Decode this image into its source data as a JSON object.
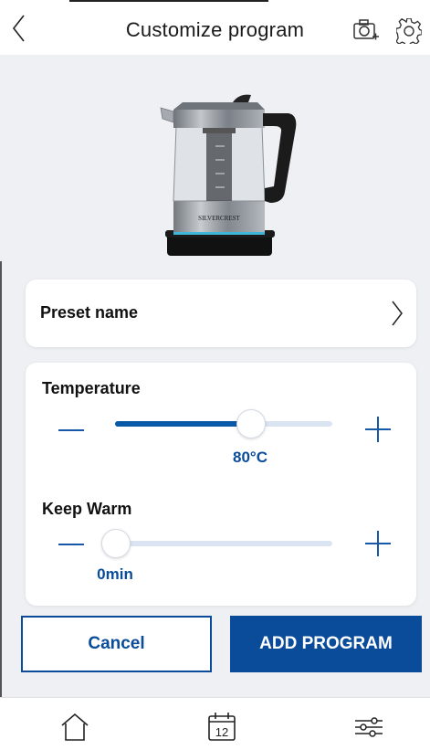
{
  "header": {
    "title": "Customize program",
    "back_icon": "chevron-left-icon",
    "camera_icon": "camera-add-icon",
    "settings_icon": "gear-icon"
  },
  "product": {
    "brand_text": "SILVERCREST"
  },
  "preset": {
    "label": "Preset name"
  },
  "temperature": {
    "label": "Temperature",
    "value_text": "80°C",
    "level_fraction": 0.62
  },
  "keep_warm": {
    "label": "Keep Warm",
    "value_text": "0min",
    "level_fraction": 0.0
  },
  "buttons": {
    "cancel": "Cancel",
    "add": "ADD PROGRAM"
  },
  "nav": {
    "calendar_day": "12"
  },
  "colors": {
    "accent": "#0a4c9a",
    "slider_fill": "#0a59a8",
    "slider_track": "#dbe4f2",
    "background": "#eef0f4"
  }
}
